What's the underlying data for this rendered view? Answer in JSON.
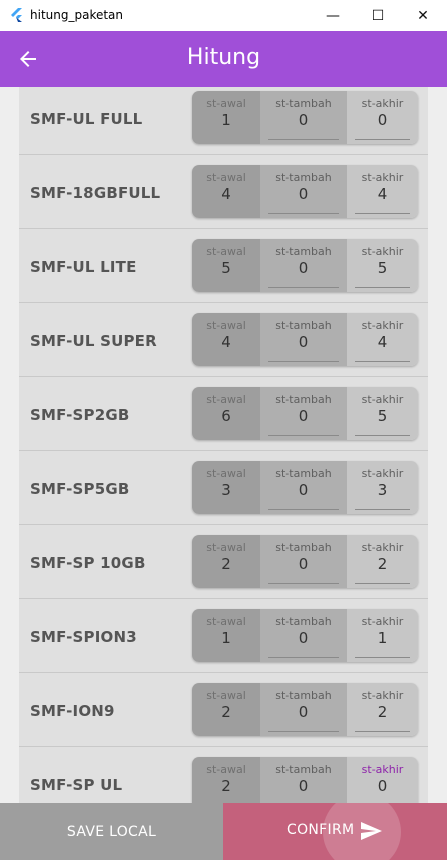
{
  "window": {
    "title": "hitung_paketan",
    "minimize_glyph": "—",
    "maximize_glyph": "☐",
    "close_glyph": "✕"
  },
  "appbar": {
    "title": "Hitung",
    "back_icon": "arrow-left-icon",
    "color": "#a04fd8"
  },
  "columns": {
    "awal": "st-awal",
    "tambah": "st-tambah",
    "akhir": "st-akhir"
  },
  "rows": [
    {
      "name": "SMF-UL FULL",
      "awal": "1",
      "tambah": "0",
      "akhir": "0"
    },
    {
      "name": "SMF-18GBFULL",
      "awal": "4",
      "tambah": "0",
      "akhir": "4"
    },
    {
      "name": "SMF-UL LITE",
      "awal": "5",
      "tambah": "0",
      "akhir": "5"
    },
    {
      "name": "SMF-UL SUPER",
      "awal": "4",
      "tambah": "0",
      "akhir": "4"
    },
    {
      "name": "SMF-SP2GB",
      "awal": "6",
      "tambah": "0",
      "akhir": "5"
    },
    {
      "name": "SMF-SP5GB",
      "awal": "3",
      "tambah": "0",
      "akhir": "3"
    },
    {
      "name": "SMF-SP 10GB",
      "awal": "2",
      "tambah": "0",
      "akhir": "2"
    },
    {
      "name": "SMF-SPION3",
      "awal": "1",
      "tambah": "0",
      "akhir": "1"
    },
    {
      "name": "SMF-ION9",
      "awal": "2",
      "tambah": "0",
      "akhir": "2"
    },
    {
      "name": "SMF-SP UL",
      "awal": "2",
      "tambah": "0",
      "akhir": "0"
    }
  ],
  "buttons": {
    "save_label": "SAVE LOCAL",
    "confirm_label": "CONFIRM",
    "confirm_icon": "send-icon",
    "confirm_color": "#c4617c"
  }
}
